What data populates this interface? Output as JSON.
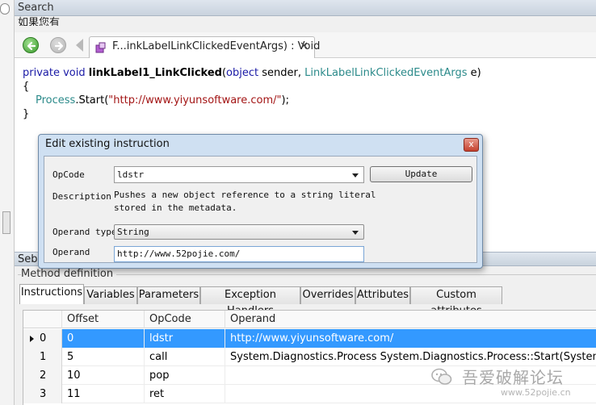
{
  "search": {
    "title": "Search",
    "cut_text": "如果您有"
  },
  "editor_tab": {
    "title": "F...inkLabelLinkClickedEventArgs) : Void",
    "close": "✕"
  },
  "code": {
    "line1": {
      "kw": "private void ",
      "name": "linkLabel1_LinkClicked",
      "p1": "(",
      "p2": "object",
      "p3": " sender, ",
      "p4": "LinkLabelLinkClickedEventArgs",
      "p5": " e)"
    },
    "line2": "{",
    "line3": {
      "ty": "Process",
      "rest": ".Start(",
      "str": "\"http://www.yiyunsoftware.com/\"",
      "end": ");"
    },
    "line4": "}"
  },
  "section": {
    "label": "Seba",
    "method_definition": "Method definition"
  },
  "tabs": [
    {
      "label": "Instructions"
    },
    {
      "label": "Variables"
    },
    {
      "label": "Parameters"
    },
    {
      "label": "Exception Handlers"
    },
    {
      "label": "Overrides"
    },
    {
      "label": "Attributes"
    },
    {
      "label": "Custom attributes"
    }
  ],
  "grid": {
    "columns": [
      "Offset",
      "OpCode",
      "Operand"
    ],
    "rows": [
      {
        "index": "0",
        "offset": "0",
        "opcode": "ldstr",
        "operand": "http://www.yiyunsoftware.com/"
      },
      {
        "index": "1",
        "offset": "5",
        "opcode": "call",
        "operand": "System.Diagnostics.Process System.Diagnostics.Process::Start(System.String)"
      },
      {
        "index": "2",
        "offset": "10",
        "opcode": "pop",
        "operand": ""
      },
      {
        "index": "3",
        "offset": "11",
        "opcode": "ret",
        "operand": ""
      }
    ]
  },
  "dialog": {
    "title": "Edit existing instruction",
    "close": "x",
    "opcode_label": "OpCode",
    "opcode_value": "ldstr",
    "update_label": "Update",
    "description_label": "Description",
    "description_line1": "Pushes a new object reference to a string literal",
    "description_line2": "stored in the metadata.",
    "operand_type_label": "Operand type",
    "operand_type_value": "String",
    "operand_label": "Operand",
    "operand_value": "http://www.52pojie.com/"
  },
  "watermark": {
    "text": "吾爱破解论坛",
    "url": "www.52pojie.cn"
  }
}
